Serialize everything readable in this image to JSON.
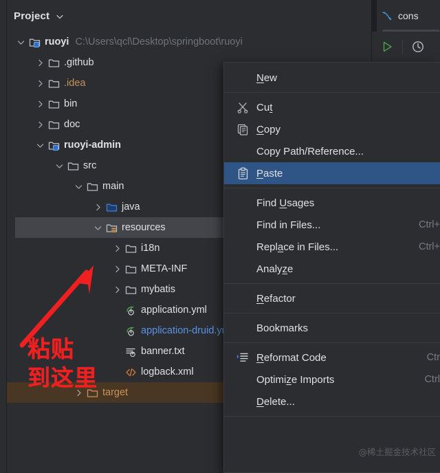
{
  "panel": {
    "title": "Project",
    "chevron_icon": "chevron-down-icon"
  },
  "editor_tab": {
    "label": "cons",
    "icon": "mysql-dolphin-icon"
  },
  "toolbar": {
    "run_icon": "run-play-icon",
    "history_icon": "clock-history-icon"
  },
  "tree": [
    {
      "id": "ruoyi",
      "label": "ruoyi",
      "path": "C:\\Users\\qcl\\Desktop\\springboot\\ruoyi",
      "indent": 0,
      "arrow": "down",
      "icon": "module-folder-icon",
      "bold": true,
      "state": "normal"
    },
    {
      "id": "github",
      "label": ".github",
      "path": "",
      "indent": 1,
      "arrow": "right",
      "icon": "folder-icon",
      "bold": false,
      "state": "normal"
    },
    {
      "id": "idea",
      "label": ".idea",
      "path": "",
      "indent": 1,
      "arrow": "right",
      "icon": "folder-icon",
      "bold": false,
      "state": "orange"
    },
    {
      "id": "bin",
      "label": "bin",
      "path": "",
      "indent": 1,
      "arrow": "right",
      "icon": "folder-icon",
      "bold": false,
      "state": "normal"
    },
    {
      "id": "doc",
      "label": "doc",
      "path": "",
      "indent": 1,
      "arrow": "right",
      "icon": "folder-icon",
      "bold": false,
      "state": "normal"
    },
    {
      "id": "ruoyi-admin",
      "label": "ruoyi-admin",
      "path": "",
      "indent": 1,
      "arrow": "down",
      "icon": "module-folder-icon",
      "bold": true,
      "state": "normal"
    },
    {
      "id": "src",
      "label": "src",
      "path": "",
      "indent": 2,
      "arrow": "down",
      "icon": "folder-icon",
      "bold": false,
      "state": "normal"
    },
    {
      "id": "main",
      "label": "main",
      "path": "",
      "indent": 3,
      "arrow": "down",
      "icon": "folder-icon",
      "bold": false,
      "state": "normal"
    },
    {
      "id": "java",
      "label": "java",
      "path": "",
      "indent": 4,
      "arrow": "right",
      "icon": "source-folder-icon",
      "bold": false,
      "state": "normal"
    },
    {
      "id": "resources",
      "label": "resources",
      "path": "",
      "indent": 4,
      "arrow": "down",
      "icon": "resource-folder-icon",
      "bold": false,
      "state": "selected"
    },
    {
      "id": "i18n",
      "label": "i18n",
      "path": "",
      "indent": 5,
      "arrow": "right",
      "icon": "folder-icon",
      "bold": false,
      "state": "normal"
    },
    {
      "id": "meta-inf",
      "label": "META-INF",
      "path": "",
      "indent": 5,
      "arrow": "right",
      "icon": "folder-icon",
      "bold": false,
      "state": "normal"
    },
    {
      "id": "mybatis",
      "label": "mybatis",
      "path": "",
      "indent": 5,
      "arrow": "right",
      "icon": "folder-icon",
      "bold": false,
      "state": "normal"
    },
    {
      "id": "application-yml",
      "label": "application.yml",
      "path": "",
      "indent": 5,
      "arrow": "none",
      "icon": "spring-yaml-icon",
      "bold": false,
      "state": "normal"
    },
    {
      "id": "application-druid-yml",
      "label": "application-druid.yml",
      "path": "",
      "indent": 5,
      "arrow": "none",
      "icon": "spring-yaml-icon",
      "bold": false,
      "state": "blue"
    },
    {
      "id": "banner-txt",
      "label": "banner.txt",
      "path": "",
      "indent": 5,
      "arrow": "none",
      "icon": "text-file-icon",
      "bold": false,
      "state": "normal"
    },
    {
      "id": "logback-xml",
      "label": "logback.xml",
      "path": "",
      "indent": 5,
      "arrow": "none",
      "icon": "xml-file-icon",
      "bold": false,
      "state": "normal"
    },
    {
      "id": "target",
      "label": "target",
      "path": "",
      "indent": 3,
      "arrow": "right",
      "icon": "excluded-folder-icon",
      "bold": false,
      "state": "excluded"
    }
  ],
  "context_menu": [
    {
      "kind": "item",
      "id": "new",
      "label_pre": "",
      "label_mn": "N",
      "label_post": "ew",
      "icon": "",
      "shortcut": ""
    },
    {
      "kind": "sep"
    },
    {
      "kind": "item",
      "id": "cut",
      "label_pre": "Cu",
      "label_mn": "t",
      "label_post": "",
      "icon": "scissors-icon",
      "shortcut": ""
    },
    {
      "kind": "item",
      "id": "copy",
      "label_pre": "",
      "label_mn": "C",
      "label_post": "opy",
      "icon": "copy-icon",
      "shortcut": ""
    },
    {
      "kind": "item",
      "id": "copy-path-reference",
      "label_pre": "Copy Path/Reference...",
      "label_mn": "",
      "label_post": "",
      "icon": "",
      "shortcut": ""
    },
    {
      "kind": "item",
      "id": "paste",
      "label_pre": "",
      "label_mn": "P",
      "label_post": "aste",
      "icon": "paste-icon",
      "shortcut": "",
      "selected": true
    },
    {
      "kind": "sep"
    },
    {
      "kind": "item",
      "id": "find-usages",
      "label_pre": "Find ",
      "label_mn": "U",
      "label_post": "sages",
      "icon": "",
      "shortcut": ""
    },
    {
      "kind": "item",
      "id": "find-in-files",
      "label_pre": "Find in Files...",
      "label_mn": "",
      "label_post": "",
      "icon": "",
      "shortcut": "Ctrl+"
    },
    {
      "kind": "item",
      "id": "replace-in-files",
      "label_pre": "Repl",
      "label_mn": "a",
      "label_post": "ce in Files...",
      "icon": "",
      "shortcut": "Ctrl+"
    },
    {
      "kind": "item",
      "id": "analyze",
      "label_pre": "Analy",
      "label_mn": "z",
      "label_post": "e",
      "icon": "",
      "shortcut": ""
    },
    {
      "kind": "sep"
    },
    {
      "kind": "item",
      "id": "refactor",
      "label_pre": "",
      "label_mn": "R",
      "label_post": "efactor",
      "icon": "",
      "shortcut": ""
    },
    {
      "kind": "sep"
    },
    {
      "kind": "item",
      "id": "bookmarks",
      "label_pre": "Bookmarks",
      "label_mn": "",
      "label_post": "",
      "icon": "",
      "shortcut": ""
    },
    {
      "kind": "sep"
    },
    {
      "kind": "item",
      "id": "reformat-code",
      "label_pre": "",
      "label_mn": "R",
      "label_post": "eformat Code",
      "icon": "reformat-icon",
      "shortcut": "Ctr"
    },
    {
      "kind": "item",
      "id": "optimize-imports",
      "label_pre": "Optimi",
      "label_mn": "z",
      "label_post": "e Imports",
      "icon": "",
      "shortcut": "Ctrl"
    },
    {
      "kind": "item",
      "id": "delete",
      "label_pre": "",
      "label_mn": "D",
      "label_post": "elete...",
      "icon": "",
      "shortcut": ""
    },
    {
      "kind": "sep"
    }
  ],
  "annotation": {
    "line1": "粘贴",
    "line2": "到这里",
    "color": "#f02020",
    "arrow_icon": "red-arrow-icon"
  },
  "watermark": {
    "text": "@稀土掘金技术社区"
  },
  "colors": {
    "background": "#2b2d30",
    "selection": "#43454a",
    "menu_highlight": "#2f5586",
    "excluded": "#4a3723",
    "text": "#dfe1e5",
    "muted": "#6f737a",
    "annotation_red": "#f02020",
    "orange": "#c9915a",
    "blue_file": "#5a93e6",
    "green": "#5a9e4a"
  }
}
